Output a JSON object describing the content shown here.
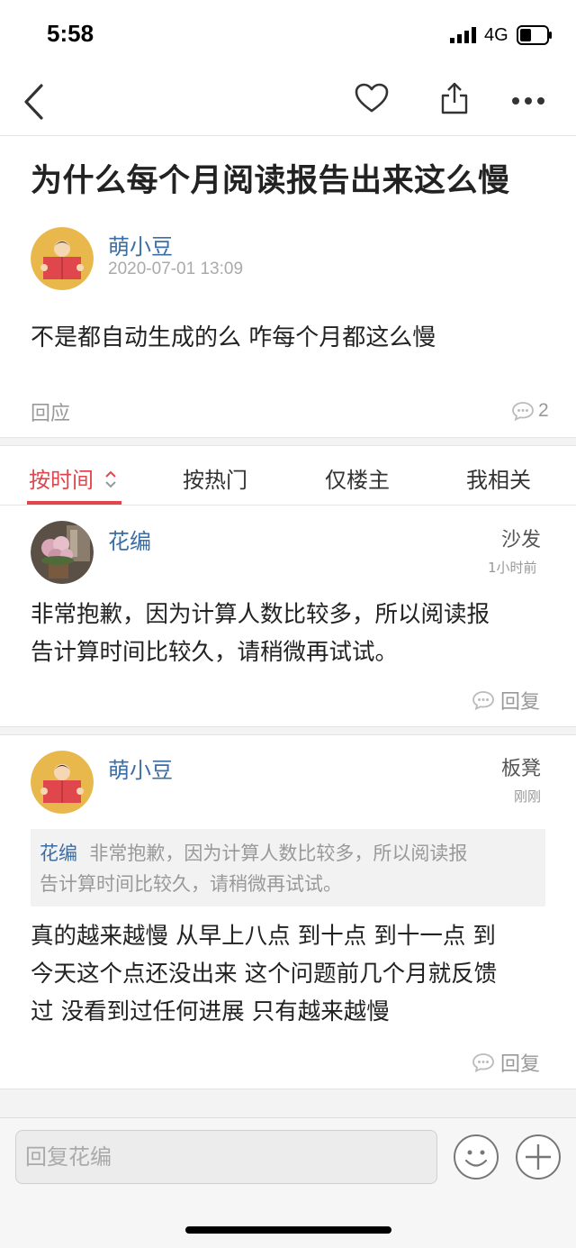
{
  "status_bar": {
    "time": "5:58",
    "network": "4G"
  },
  "nav": {
    "back_icon": "chevron-left-icon",
    "fav_icon": "heart-icon",
    "share_icon": "share-icon",
    "more_icon": "more-icon"
  },
  "post": {
    "title": "为什么每个月阅读报告出来这么慢",
    "author": "萌小豆",
    "date": "2020-07-01 13:09",
    "body": "不是都自动生成的么 咋每个月都这么慢",
    "respond_label": "回应",
    "comment_count": "2"
  },
  "tabs": [
    {
      "label": "按时间",
      "active": true
    },
    {
      "label": "按热门",
      "active": false
    },
    {
      "label": "仅楼主",
      "active": false
    },
    {
      "label": "我相关",
      "active": false
    }
  ],
  "comments": [
    {
      "author": "花编",
      "rank": "沙发",
      "time": "1小时前",
      "text_lines": [
        "非常抱歉，因为计算人数比较多，所以阅读报",
        "告计算时间比较久，请稍微再试试。"
      ],
      "reply_label": "回复"
    },
    {
      "author": "萌小豆",
      "rank": "板凳",
      "time": "刚刚",
      "quote": {
        "author": "花编",
        "line1": "非常抱歉，因为计算人数比较多，所以阅读报",
        "line2": "告计算时间比较久，请稍微再试试。"
      },
      "text_lines": [
        "真的越来越慢 从早上八点 到十点 到十一点 到",
        "今天这个点还没出来 这个问题前几个月就反馈",
        "过 没看到过任何进展 只有越来越慢"
      ],
      "reply_label": "回复"
    }
  ],
  "reply_bar": {
    "placeholder": "回复花编",
    "emoji_icon": "smiley-icon",
    "add_icon": "plus-circle-icon"
  },
  "colors": {
    "accent": "#e0474c",
    "link": "#3a6ea5",
    "muted": "#999999"
  }
}
